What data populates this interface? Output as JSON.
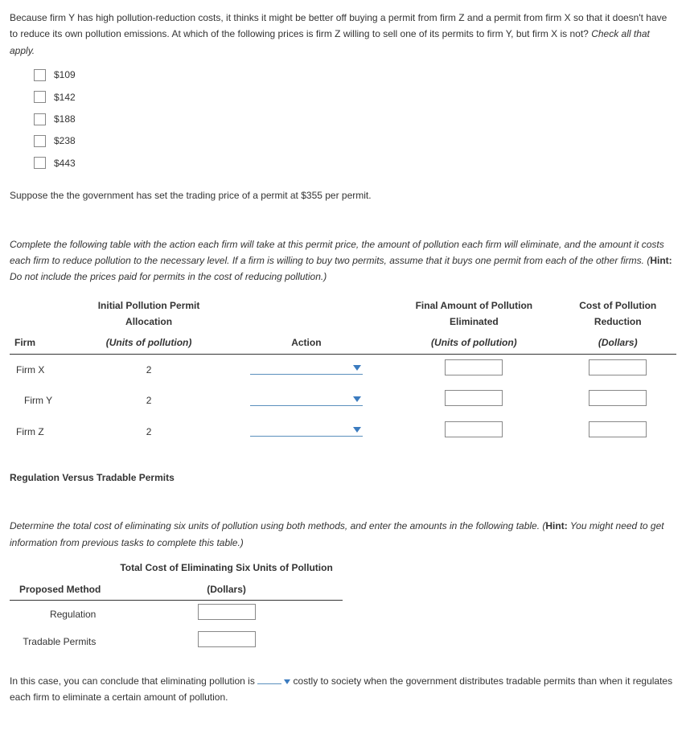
{
  "q1": {
    "intro": "Because firm Y has high pollution-reduction costs, it thinks it might be better off buying a permit from firm Z and a permit from firm X so that it doesn't have to reduce its own pollution emissions. At which of the following prices is firm Z willing to sell one of its permits to firm Y, but firm X is not? ",
    "intro_italic": "Check all that apply.",
    "options": [
      "$109",
      "$142",
      "$188",
      "$238",
      "$443"
    ]
  },
  "q2": {
    "setup": "Suppose the the government has set the trading price of a permit at $355 per permit.",
    "instruction": "Complete the following table with the action each firm will take at this permit price, the amount of pollution each firm will eliminate, and the amount it costs each firm to reduce pollution to the necessary level. If a firm is willing to buy two permits, assume that it buys one permit from each of the other firms. (",
    "hint_label": "Hint:",
    "hint_text": " Do not include the prices paid for permits in the cost of reducing pollution.)",
    "headers": {
      "firm": "Firm",
      "alloc1": "Initial Pollution Permit",
      "alloc2": "Allocation",
      "alloc3": "(Units of pollution)",
      "action": "Action",
      "final1": "Final Amount of Pollution",
      "final2": "Eliminated",
      "final3": "(Units of pollution)",
      "cost1": "Cost of Pollution",
      "cost2": "Reduction",
      "cost3": "(Dollars)"
    },
    "rows": [
      {
        "firm": "Firm X",
        "alloc": "2"
      },
      {
        "firm": "Firm Y",
        "alloc": "2"
      },
      {
        "firm": "Firm Z",
        "alloc": "2"
      }
    ]
  },
  "q3": {
    "title": "Regulation Versus Tradable Permits",
    "instruction": "Determine the total cost of eliminating six units of pollution using both methods, and enter the amounts in the following table. (",
    "hint_label": "Hint:",
    "hint_text": " You might need to get information from previous tasks to complete this table.)",
    "headers": {
      "method": "Proposed Method",
      "cost1": "Total Cost of Eliminating Six Units of Pollution",
      "cost2": "(Dollars)"
    },
    "rows": [
      "Regulation",
      "Tradable Permits"
    ]
  },
  "q4": {
    "text1": "In this case, you can conclude that eliminating pollution is ",
    "text2": " costly to society when the government distributes tradable permits than when it regulates each firm to eliminate a certain amount of pollution."
  }
}
